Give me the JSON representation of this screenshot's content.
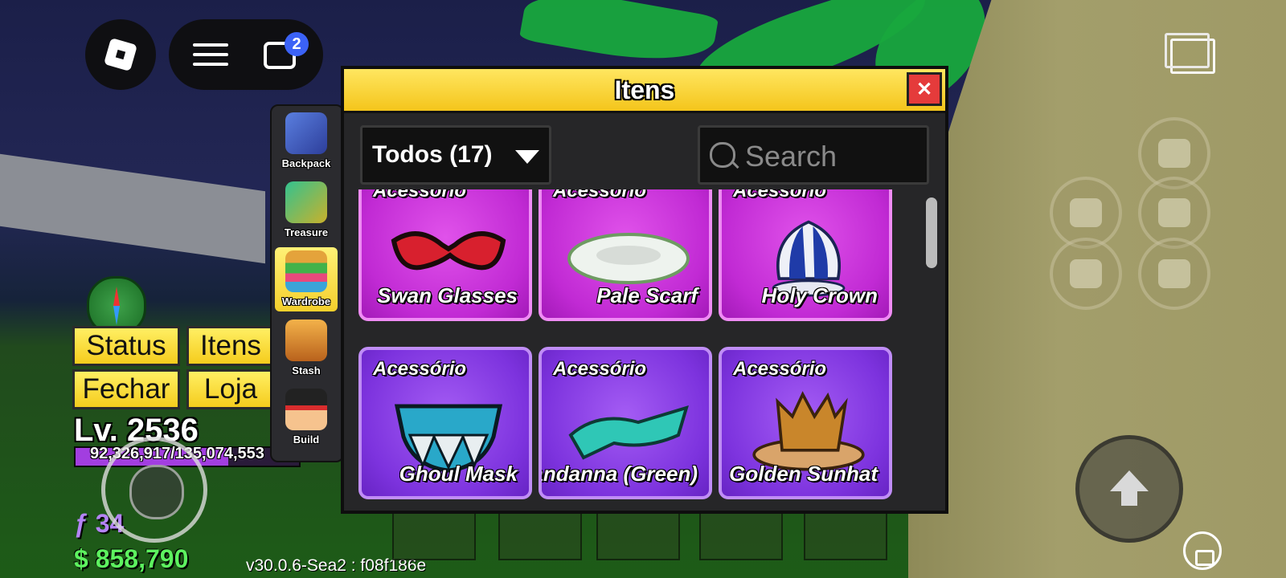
{
  "top": {
    "chat_badge": "2"
  },
  "sidebar": {
    "items": [
      {
        "label": "Backpack",
        "icon": "backpack-icon",
        "active": false
      },
      {
        "label": "Treasure",
        "icon": "treasure-icon",
        "active": false
      },
      {
        "label": "Wardrobe",
        "icon": "wardrobe-icon",
        "active": true
      },
      {
        "label": "Stash",
        "icon": "stash-chest-icon",
        "active": false
      },
      {
        "label": "Build",
        "icon": "build-avatar-icon",
        "active": false
      }
    ]
  },
  "hud": {
    "buttons": {
      "status": "Status",
      "itens": "Itens",
      "fechar": "Fechar",
      "loja": "Loja"
    },
    "level": "Lv. 2536",
    "xp": "92,326,917/135,074,553",
    "xp_fraction": 0.684,
    "fragments": "ƒ 34",
    "money": "$ 858,790",
    "version": "v30.0.6-Sea2 : f08f186e"
  },
  "panel": {
    "title": "Itens",
    "filter": "Todos (17)",
    "search_placeholder": "Search",
    "items": [
      {
        "category": "Acessório",
        "name": "Swan Glasses",
        "rarity": "pink"
      },
      {
        "category": "Acessório",
        "name": "Pale Scarf",
        "rarity": "pink"
      },
      {
        "category": "Acessório",
        "name": "Holy Crown",
        "rarity": "pink"
      },
      {
        "category": "Acessório",
        "name": "Ghoul Mask",
        "rarity": "purple"
      },
      {
        "category": "Acessório",
        "name": "Bandanna (Green)",
        "rarity": "purple"
      },
      {
        "category": "Acessório",
        "name": "Golden Sunhat",
        "rarity": "purple"
      }
    ]
  },
  "colors": {
    "pink": "#c12ad4",
    "purple": "#7d33de",
    "title_yellow": "#f4c51b",
    "money_green": "#5df25f"
  }
}
